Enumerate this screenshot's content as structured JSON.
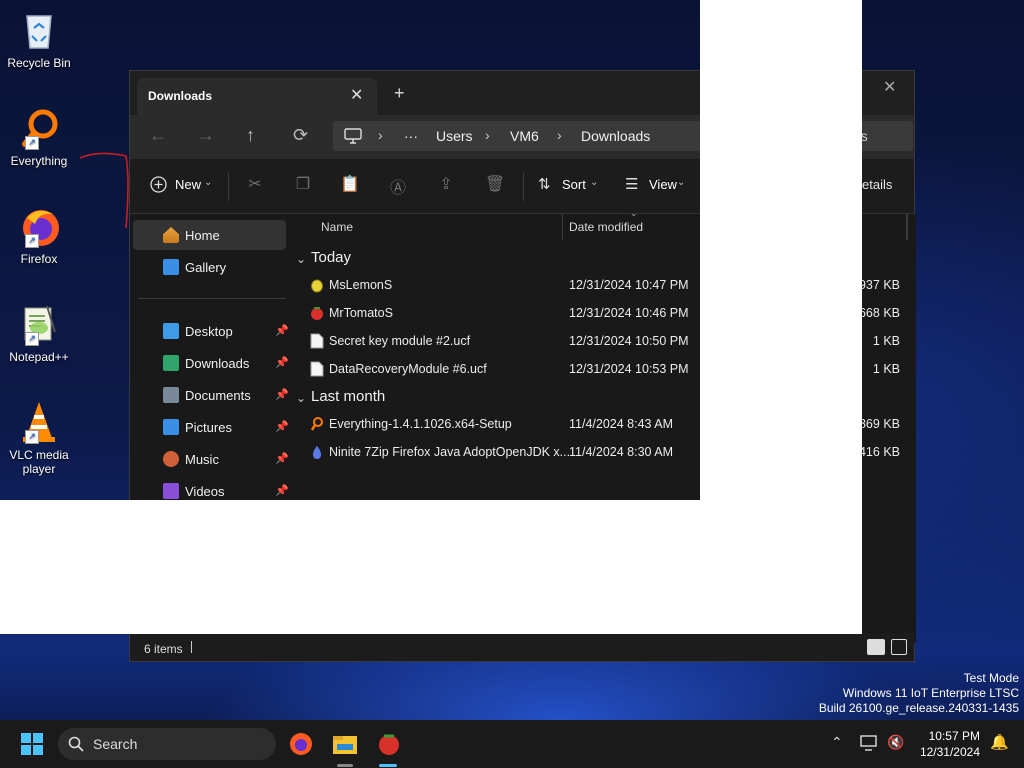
{
  "desktop": {
    "icons": [
      {
        "label": "Recycle Bin",
        "icon": "recycle-bin-icon"
      },
      {
        "label": "Everything",
        "icon": "everything-search-icon"
      },
      {
        "label": "Firefox",
        "icon": "firefox-icon"
      },
      {
        "label": "Notepad++",
        "icon": "notepad-plus-plus-icon"
      },
      {
        "label": "VLC media player",
        "icon": "vlc-cone-icon"
      }
    ]
  },
  "explorer": {
    "tab_title": "Downloads",
    "tab_close": "✕",
    "new_tab": "+",
    "window_close": "✕",
    "nav": {
      "back": "←",
      "forward": "→",
      "up": "↑",
      "refresh": "⟳"
    },
    "breadcrumb": {
      "more": "···",
      "items": [
        "Users",
        "VM6",
        "Downloads"
      ],
      "overflow_fragment": "ds"
    },
    "toolbar": {
      "new": "New",
      "sort": "Sort",
      "view": "View",
      "details_fragment": "etails"
    },
    "sidebar": {
      "top": [
        {
          "label": "Home",
          "icon": "home-icon",
          "color": "#e8a33d",
          "selected": true
        },
        {
          "label": "Gallery",
          "icon": "gallery-icon",
          "color": "#3a8ee6"
        }
      ],
      "pinned": [
        {
          "label": "Desktop",
          "icon": "desktop-folder-icon",
          "color": "#3f9be8"
        },
        {
          "label": "Downloads",
          "icon": "downloads-folder-icon",
          "color": "#2fa36b"
        },
        {
          "label": "Documents",
          "icon": "documents-folder-icon",
          "color": "#7a8899"
        },
        {
          "label": "Pictures",
          "icon": "pictures-folder-icon",
          "color": "#3a8ee6"
        },
        {
          "label": "Music",
          "icon": "music-folder-icon",
          "color": "#d0603a"
        },
        {
          "label": "Videos",
          "icon": "videos-folder-icon",
          "color": "#8a4fd8"
        }
      ]
    },
    "columns": {
      "name": "Name",
      "date": "Date modified"
    },
    "groups": [
      {
        "label": "Today",
        "files": [
          {
            "name": "MsLemonS",
            "date": "12/31/2024 10:47 PM",
            "size": "937 KB",
            "icon": "lemon-app-icon"
          },
          {
            "name": "MrTomatoS",
            "date": "12/31/2024 10:46 PM",
            "size": "668 KB",
            "icon": "tomato-app-icon"
          },
          {
            "name": "Secret key module #2.ucf",
            "date": "12/31/2024 10:50 PM",
            "size": "1 KB",
            "icon": "file-icon"
          },
          {
            "name": "DataRecoveryModule #6.ucf",
            "date": "12/31/2024 10:53 PM",
            "size": "1 KB",
            "icon": "file-icon"
          }
        ]
      },
      {
        "label": "Last month",
        "files": [
          {
            "name": "Everything-1.4.1.1026.x64-Setup",
            "date": "11/4/2024 8:43 AM",
            "size": "869 KB",
            "icon": "everything-search-icon"
          },
          {
            "name": "Ninite 7Zip Firefox Java AdoptOpenJDK x...",
            "date": "11/4/2024 8:30 AM",
            "size": "416 KB",
            "icon": "ninite-icon"
          }
        ]
      }
    ],
    "status": {
      "count": "6 items"
    }
  },
  "watermark": {
    "line1": "Test Mode",
    "line2": "Windows 11 IoT Enterprise LTSC",
    "line3": "Build 26100.ge_release.240331-1435"
  },
  "taskbar": {
    "search_placeholder": "Search",
    "time": "10:57 PM",
    "date": "12/31/2024",
    "colors": {
      "accent": "#4cc2ff"
    }
  }
}
